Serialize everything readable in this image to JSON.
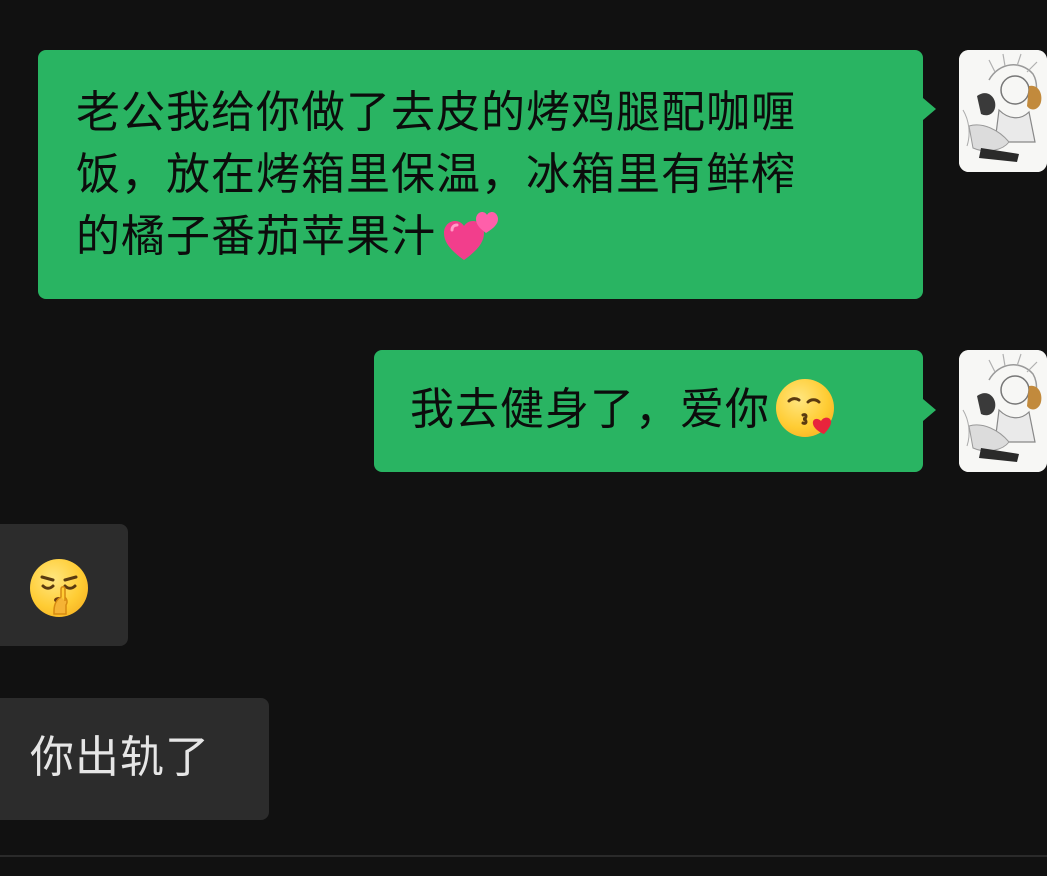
{
  "messages": [
    {
      "side": "outgoing",
      "text_line1": "老公我给你做了去皮的烤鸡腿配咖喱",
      "text_line2": "饭，放在烤箱里保温，冰箱里有鲜榨",
      "text_line3": "的橘子番茄苹果汁",
      "emoji": "two-hearts"
    },
    {
      "side": "outgoing",
      "text": "我去健身了，爱你",
      "emoji": "face-blowing-kiss"
    },
    {
      "side": "incoming",
      "emoji": "shushing-face"
    },
    {
      "side": "incoming",
      "text": "你出轨了"
    }
  ],
  "colors": {
    "background": "#111111",
    "outgoing_bubble": "#29B462",
    "incoming_bubble": "#2C2C2C"
  }
}
